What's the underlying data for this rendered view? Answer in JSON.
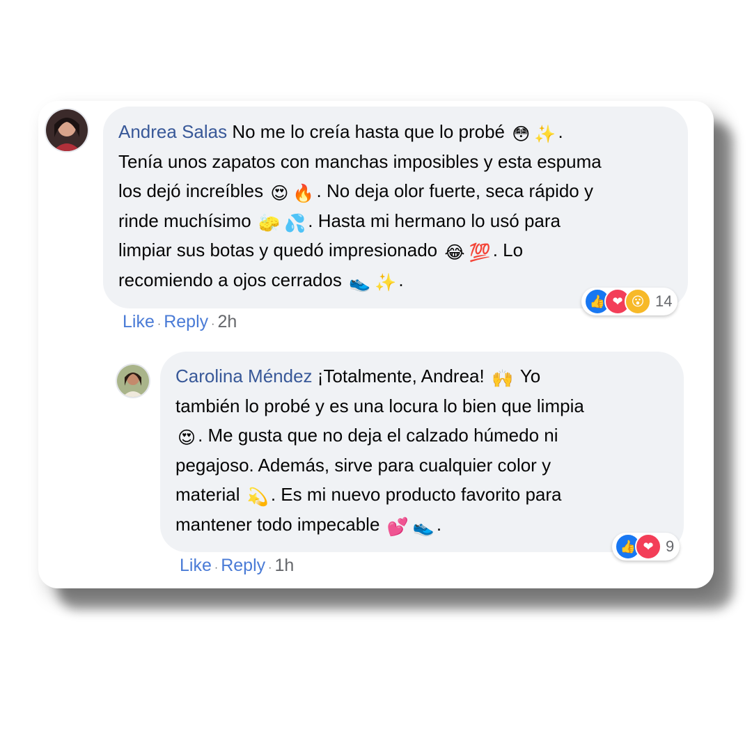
{
  "comments": [
    {
      "author": "Andrea Salas",
      "lines": [
        [
          "No me lo creía hasta que lo probé ",
          {
            "emoji": "😳"
          },
          {
            "emoji": "✨"
          },
          "."
        ],
        [
          "Tenía unos zapatos con manchas imposibles y esta espuma"
        ],
        [
          "los dejó increíbles ",
          {
            "emoji": "😍"
          },
          {
            "emoji": "🔥"
          },
          ". No deja olor fuerte, seca rápido y"
        ],
        [
          "rinde muchísimo ",
          {
            "emoji": "🧽"
          },
          {
            "emoji": "💦"
          },
          ". Hasta mi hermano lo usó para"
        ],
        [
          "limpiar sus botas y quedó impresionado ",
          {
            "emoji": "😂"
          },
          {
            "emoji": "💯"
          },
          ". Lo"
        ],
        [
          "recomiendo a ojos cerrados ",
          {
            "emoji": "👟"
          },
          {
            "emoji": "✨"
          },
          "."
        ]
      ],
      "reactions": {
        "icons": [
          "like",
          "love",
          "wow"
        ],
        "count": "14"
      },
      "actions": {
        "like": "Like",
        "reply": "Reply",
        "time": "2h"
      }
    },
    {
      "author": "Carolina Méndez",
      "lines": [
        [
          "¡Totalmente, Andrea! ",
          {
            "emoji": "🙌"
          },
          " Yo"
        ],
        [
          "también lo probé y es una locura lo bien que limpia"
        ],
        [
          {
            "emoji": "😍"
          },
          ". Me gusta que no deja el calzado húmedo ni"
        ],
        [
          "pegajoso. Además, sirve para cualquier color y"
        ],
        [
          "material ",
          {
            "emoji": "💫"
          },
          ". Es mi nuevo producto favorito para"
        ],
        [
          "mantener todo impecable ",
          {
            "emoji": "💕"
          },
          {
            "emoji": "👟"
          },
          "."
        ]
      ],
      "reactions": {
        "icons": [
          "like",
          "love"
        ],
        "count": "9"
      },
      "actions": {
        "like": "Like",
        "reply": "Reply",
        "time": "1h"
      }
    }
  ],
  "action_separator": "·",
  "reaction_glyphs": {
    "like": "👍",
    "love": "❤",
    "wow": "😮"
  }
}
